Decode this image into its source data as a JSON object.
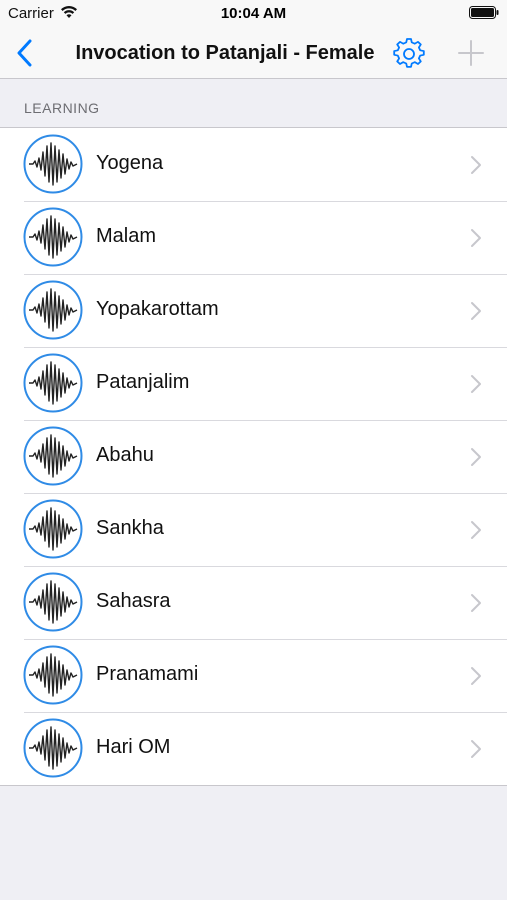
{
  "status_bar": {
    "carrier": "Carrier",
    "time": "10:04 AM"
  },
  "nav": {
    "title": "Invocation to Patanjali - Female",
    "back_icon": "chevron-left-icon",
    "settings_icon": "gear-icon",
    "add_icon": "plus-icon"
  },
  "section": {
    "header": "LEARNING"
  },
  "items": [
    {
      "label": "Yogena"
    },
    {
      "label": "Malam"
    },
    {
      "label": "Yopakarottam"
    },
    {
      "label": "Patanjalim"
    },
    {
      "label": "Abahu"
    },
    {
      "label": "Sankha"
    },
    {
      "label": "Sahasra"
    },
    {
      "label": "Pranamami"
    },
    {
      "label": "Hari OM"
    }
  ],
  "colors": {
    "accent": "#007aff",
    "background": "#efeff4",
    "icon_ring": "#2f8be6",
    "chevron": "#c7c7cc"
  }
}
